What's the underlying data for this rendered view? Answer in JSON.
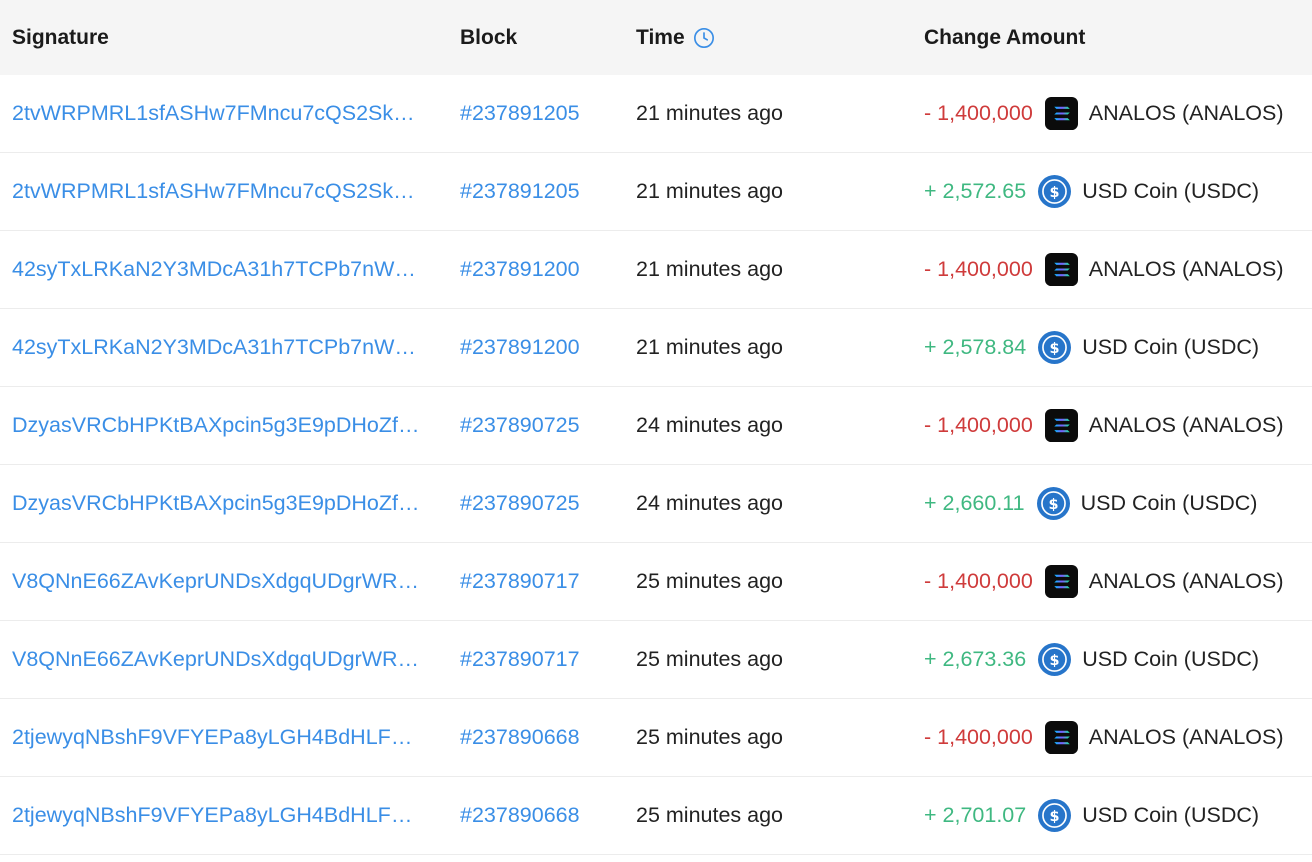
{
  "colors": {
    "link": "#3a8ee6",
    "negative": "#cf3b3b",
    "positive": "#3fb881",
    "header_bg": "#f5f5f5",
    "usdc": "#2775ca"
  },
  "header": {
    "signature": "Signature",
    "block": "Block",
    "time": "Time",
    "time_icon": "clock-icon",
    "change_amount": "Change Amount"
  },
  "rows": [
    {
      "signature": "2tvWRPMRL1sfASHw7FMncu7cQS2Sk…",
      "block": "#237891205",
      "time": "21 minutes ago",
      "amount": "- 1,400,000",
      "direction": "negative",
      "token": "ANALOS (ANALOS)",
      "token_icon": "analos-icon"
    },
    {
      "signature": "2tvWRPMRL1sfASHw7FMncu7cQS2Sk…",
      "block": "#237891205",
      "time": "21 minutes ago",
      "amount": "+ 2,572.65",
      "direction": "positive",
      "token": "USD Coin (USDC)",
      "token_icon": "usdc-icon"
    },
    {
      "signature": "42syTxLRKaN2Y3MDcA31h7TCPb7nW…",
      "block": "#237891200",
      "time": "21 minutes ago",
      "amount": "- 1,400,000",
      "direction": "negative",
      "token": "ANALOS (ANALOS)",
      "token_icon": "analos-icon"
    },
    {
      "signature": "42syTxLRKaN2Y3MDcA31h7TCPb7nW…",
      "block": "#237891200",
      "time": "21 minutes ago",
      "amount": "+ 2,578.84",
      "direction": "positive",
      "token": "USD Coin (USDC)",
      "token_icon": "usdc-icon"
    },
    {
      "signature": "DzyasVRCbHPKtBAXpcin5g3E9pDHoZf…",
      "block": "#237890725",
      "time": "24 minutes ago",
      "amount": "- 1,400,000",
      "direction": "negative",
      "token": "ANALOS (ANALOS)",
      "token_icon": "analos-icon"
    },
    {
      "signature": "DzyasVRCbHPKtBAXpcin5g3E9pDHoZf…",
      "block": "#237890725",
      "time": "24 minutes ago",
      "amount": "+ 2,660.11",
      "direction": "positive",
      "token": "USD Coin (USDC)",
      "token_icon": "usdc-icon"
    },
    {
      "signature": "V8QNnE66ZAvKeprUNDsXdgqUDgrWR…",
      "block": "#237890717",
      "time": "25 minutes ago",
      "amount": "- 1,400,000",
      "direction": "negative",
      "token": "ANALOS (ANALOS)",
      "token_icon": "analos-icon"
    },
    {
      "signature": "V8QNnE66ZAvKeprUNDsXdgqUDgrWR…",
      "block": "#237890717",
      "time": "25 minutes ago",
      "amount": "+ 2,673.36",
      "direction": "positive",
      "token": "USD Coin (USDC)",
      "token_icon": "usdc-icon"
    },
    {
      "signature": "2tjewyqNBshF9VFYEPa8yLGH4BdHLFa…",
      "block": "#237890668",
      "time": "25 minutes ago",
      "amount": "- 1,400,000",
      "direction": "negative",
      "token": "ANALOS (ANALOS)",
      "token_icon": "analos-icon"
    },
    {
      "signature": "2tjewyqNBshF9VFYEPa8yLGH4BdHLFa…",
      "block": "#237890668",
      "time": "25 minutes ago",
      "amount": "+ 2,701.07",
      "direction": "positive",
      "token": "USD Coin (USDC)",
      "token_icon": "usdc-icon"
    }
  ]
}
